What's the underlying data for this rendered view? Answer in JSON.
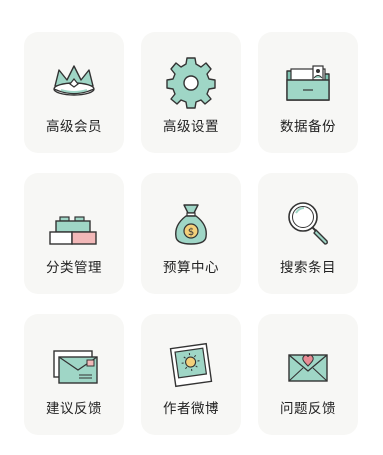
{
  "menu": {
    "items": [
      {
        "label": "高级会员",
        "icon": "crown-icon"
      },
      {
        "label": "高级设置",
        "icon": "gear-icon"
      },
      {
        "label": "数据备份",
        "icon": "folder-icon"
      },
      {
        "label": "分类管理",
        "icon": "blocks-icon"
      },
      {
        "label": "预算中心",
        "icon": "money-bag-icon"
      },
      {
        "label": "搜索条目",
        "icon": "magnifier-icon"
      },
      {
        "label": "建议反馈",
        "icon": "mail-icon"
      },
      {
        "label": "作者微博",
        "icon": "photo-icon"
      },
      {
        "label": "问题反馈",
        "icon": "heart-envelope-icon"
      }
    ]
  },
  "colors": {
    "tile_bg": "#f7f7f5",
    "mint": "#9fd6c6",
    "pink": "#f2b8b8",
    "gold": "#f3cf7a",
    "outline": "#333333"
  }
}
